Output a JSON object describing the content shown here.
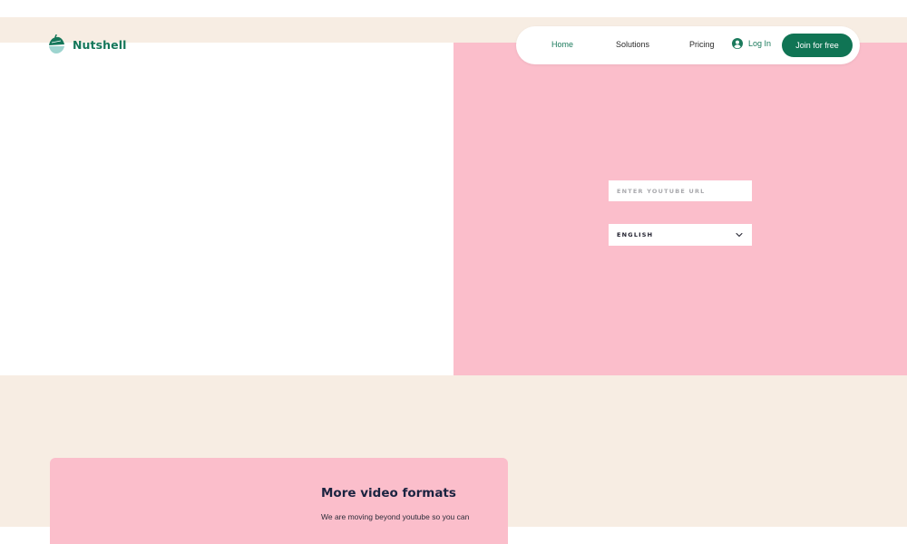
{
  "brand": {
    "name": "Nutshell"
  },
  "nav": {
    "links": [
      {
        "label": "Home",
        "active": true
      },
      {
        "label": "Solutions"
      },
      {
        "label": "Pricing"
      }
    ],
    "login_label": "Log In",
    "join_label": "Join for free"
  },
  "hero": {
    "url_input": {
      "placeholder": "ENTER YOUTUBE URL",
      "value": ""
    },
    "language_select": {
      "selected": "ENGLISH"
    }
  },
  "feature": {
    "title": "More video formats",
    "body": "We are moving beyond youtube so you can"
  },
  "icons": {
    "logo": "nut-logo-icon",
    "login": "user-circle-icon",
    "dropdown": "chevron-down-icon"
  },
  "colors": {
    "brand_green": "#107454",
    "link_green": "#1b7a5c",
    "hero_pink": "#fbbecb",
    "cream": "#f7ede3",
    "heading_navy": "#1a2340"
  }
}
